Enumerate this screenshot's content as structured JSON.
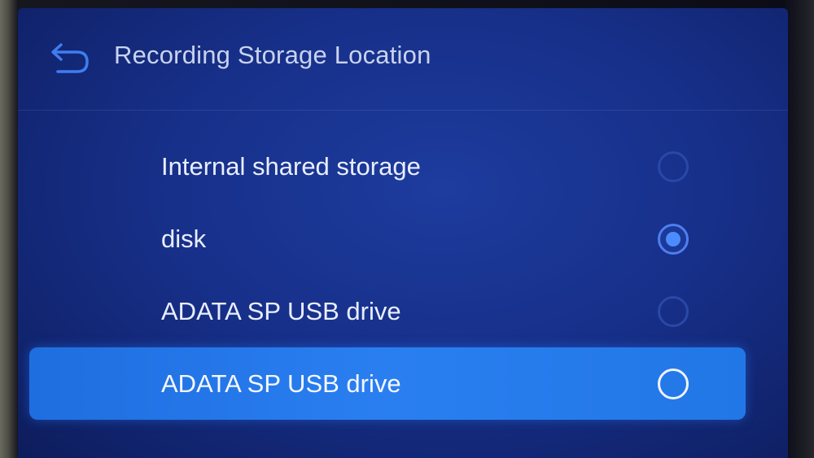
{
  "header": {
    "title": "Recording Storage Location",
    "back_icon": "back-arrow-icon"
  },
  "options": [
    {
      "label": "Internal shared storage",
      "selected": false,
      "focused": false
    },
    {
      "label": "disk",
      "selected": true,
      "focused": false
    },
    {
      "label": "ADATA SP USB drive",
      "selected": false,
      "focused": false
    },
    {
      "label": "ADATA SP USB drive",
      "selected": false,
      "focused": true
    }
  ],
  "colors": {
    "background": "#17308a",
    "focus_highlight": "#2a7ff0",
    "selected_dot": "#4d8cff",
    "text": "#e9eefb"
  }
}
